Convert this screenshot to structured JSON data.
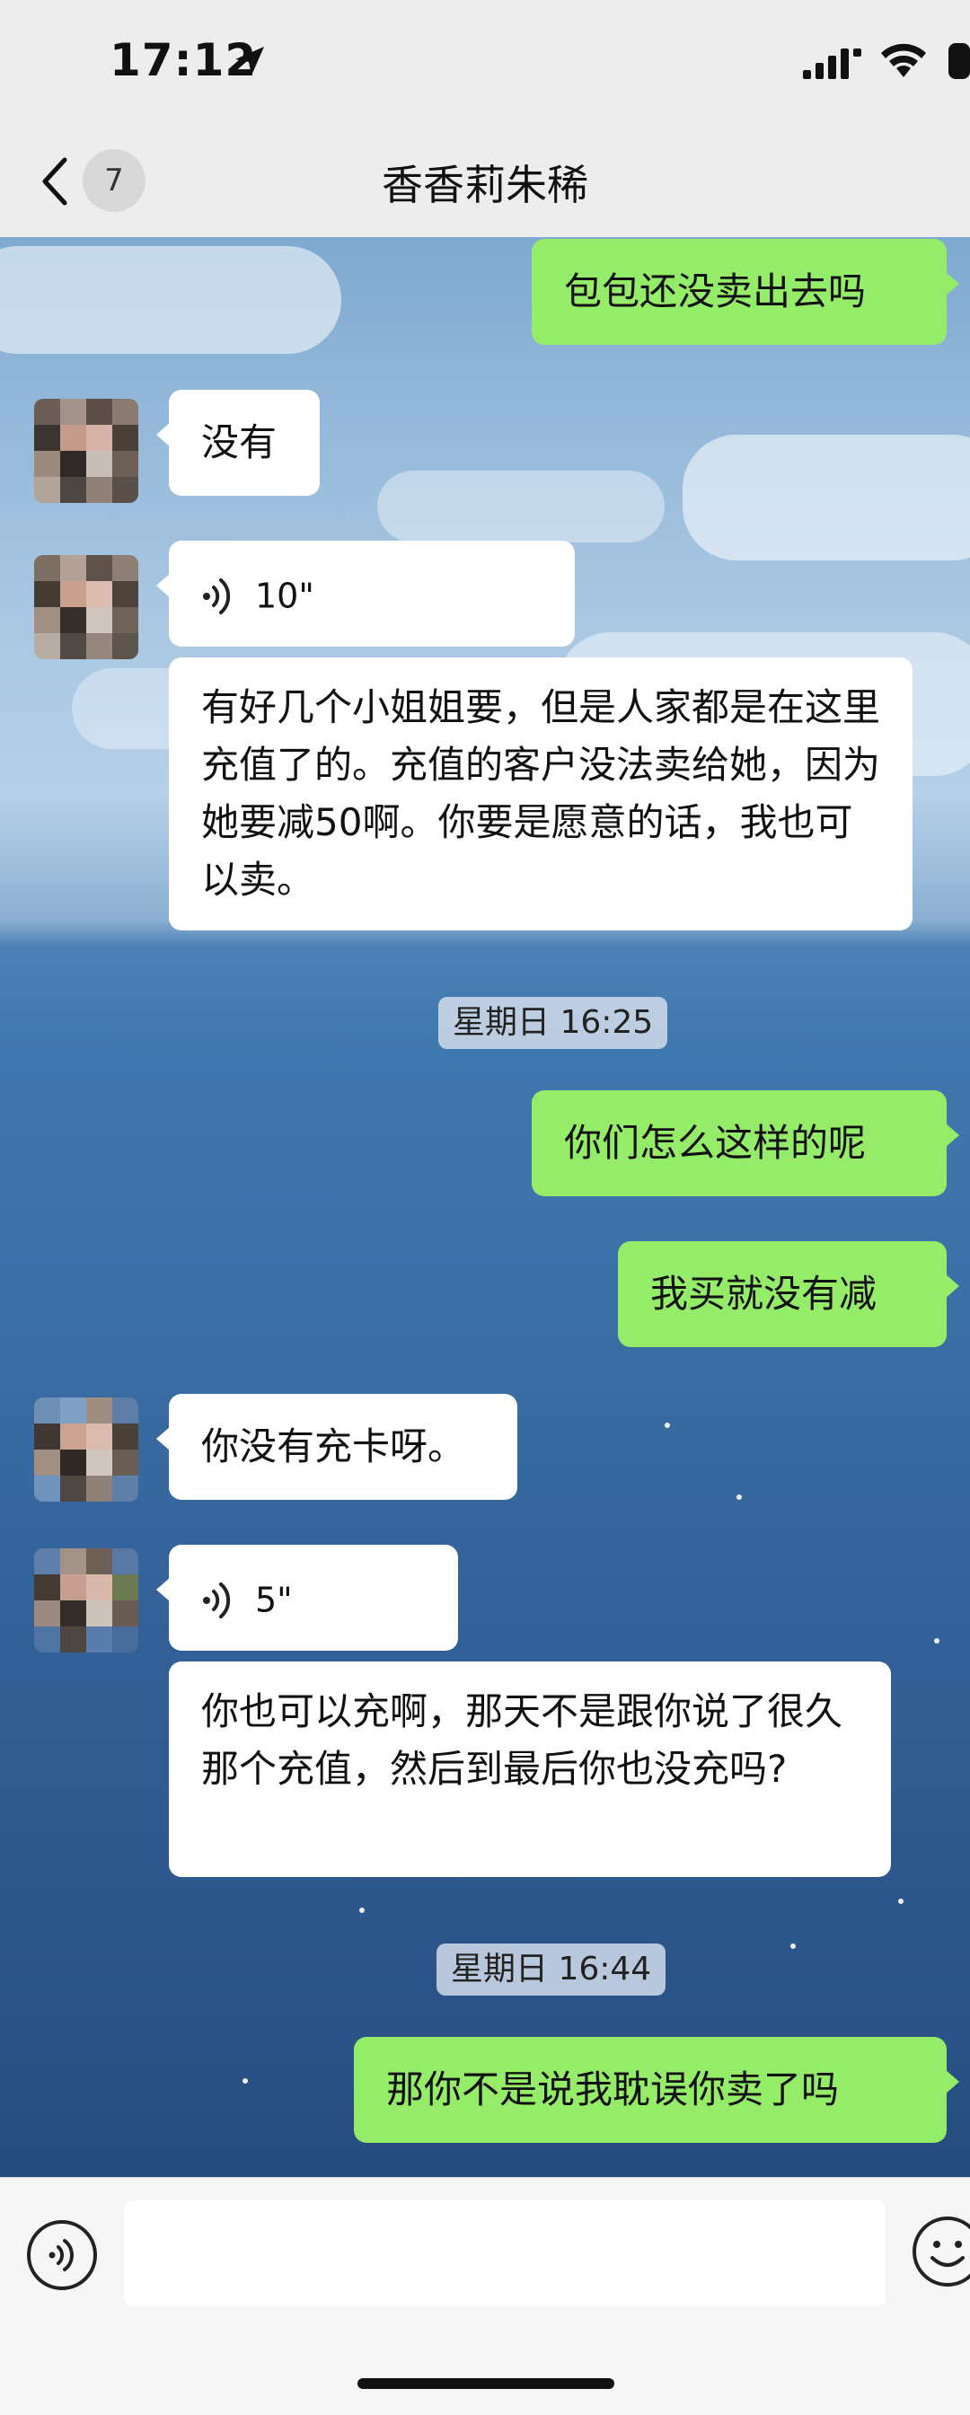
{
  "status_bar": {
    "time": "17:12"
  },
  "nav": {
    "back_badge": "7",
    "title": "香香莉朱稀"
  },
  "messages": [
    {
      "side": "out",
      "text": "包包还没卖出去吗"
    },
    {
      "side": "in",
      "text": "没有"
    },
    {
      "side": "in",
      "type": "voice",
      "duration": "10\""
    },
    {
      "side": "in",
      "text": "有好几个小姐姐要，但是人家都是在这里充值了的。充值的客户没法卖给她，因为她要减50啊。你要是愿意的话，我也可以卖。"
    },
    {
      "side": "out",
      "text": "你们怎么这样的呢"
    },
    {
      "side": "out",
      "text": "我买就没有减"
    },
    {
      "side": "in",
      "text": "你没有充卡呀。"
    },
    {
      "side": "in",
      "type": "voice",
      "duration": "5\""
    },
    {
      "side": "in",
      "text": "你也可以充啊，那天不是跟你说了很久那个充值，然后到最后你也没充吗?"
    },
    {
      "side": "out",
      "text": "那你不是说我耽误你卖了吗"
    }
  ],
  "timestamps": [
    "星期日 16:25",
    "星期日 16:44"
  ],
  "icons": {
    "back": "chevron-left-icon",
    "voice": "voice-wave-icon",
    "voice_input": "voice-input-icon",
    "emoji": "emoji-icon",
    "location": "location-arrow-icon",
    "signal": "signal-icon",
    "wifi": "wifi-icon",
    "battery": "battery-icon"
  },
  "colors": {
    "out_bubble": "#95ec69",
    "in_bubble": "#ffffff",
    "background": "#ededed"
  }
}
